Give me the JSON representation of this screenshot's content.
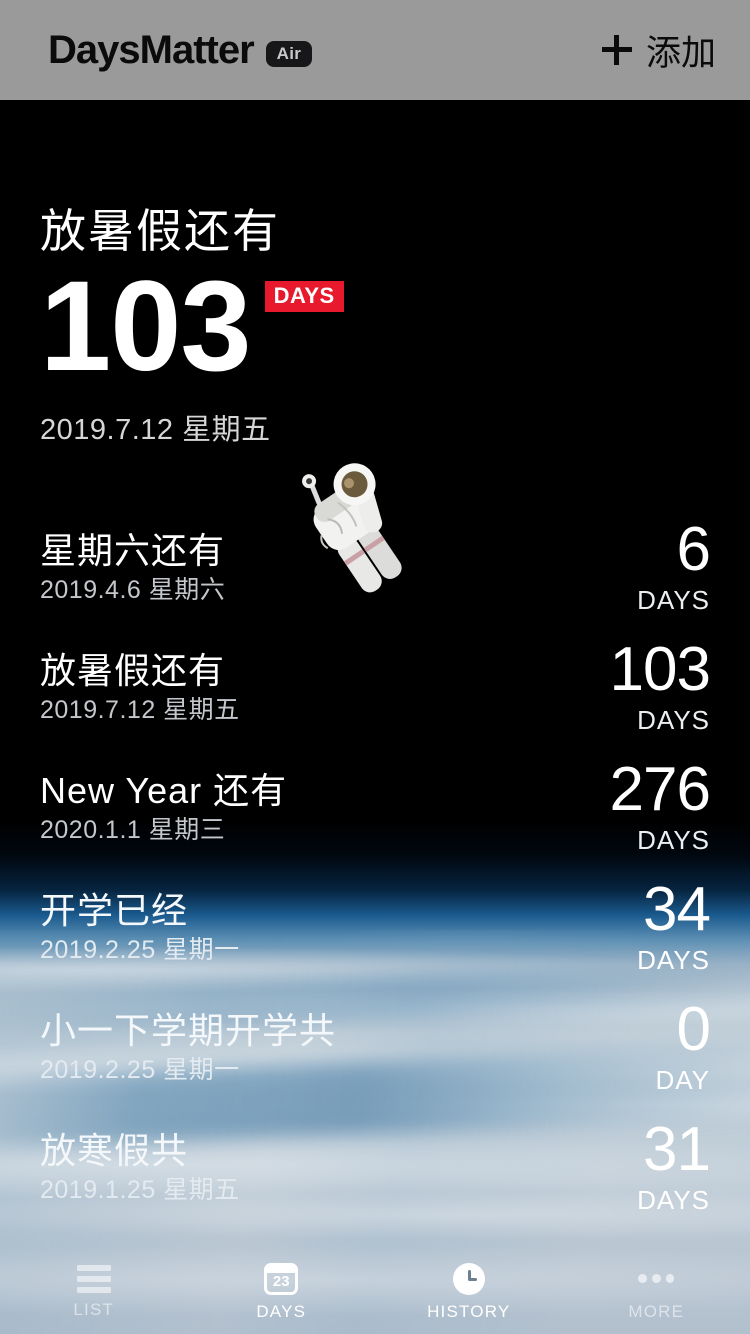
{
  "header": {
    "brand": "DaysMatter",
    "badge": "Air",
    "add_label": "添加",
    "plus_icon": "plus-icon",
    "bg_color": "#9a9a9a"
  },
  "hero": {
    "title": "放暑假还有",
    "number": "103",
    "unit_badge": "DAYS",
    "badge_color": "#e8192c",
    "date": "2019.7.12 星期五"
  },
  "events": [
    {
      "title": "星期六还有",
      "date": "2019.4.6 星期六",
      "number": "6",
      "unit": "DAYS"
    },
    {
      "title": "放暑假还有",
      "date": "2019.7.12 星期五",
      "number": "103",
      "unit": "DAYS"
    },
    {
      "title": "New Year 还有",
      "date": "2020.1.1 星期三",
      "number": "276",
      "unit": "DAYS"
    },
    {
      "title": "开学已经",
      "date": "2019.2.25 星期一",
      "number": "34",
      "unit": "DAYS"
    },
    {
      "title": "小一下学期开学共",
      "date": "2019.2.25 星期一",
      "number": "0",
      "unit": "DAY"
    },
    {
      "title": "放寒假共",
      "date": "2019.1.25 星期五",
      "number": "31",
      "unit": "DAYS"
    }
  ],
  "tabs": [
    {
      "label": "LIST",
      "icon": "list-icon",
      "active": false
    },
    {
      "label": "DAYS",
      "icon": "calendar-icon",
      "active": true,
      "calendar_day": "23"
    },
    {
      "label": "HISTORY",
      "icon": "clock-icon",
      "active": true
    },
    {
      "label": "MORE",
      "icon": "ellipsis-icon",
      "active": false
    }
  ]
}
